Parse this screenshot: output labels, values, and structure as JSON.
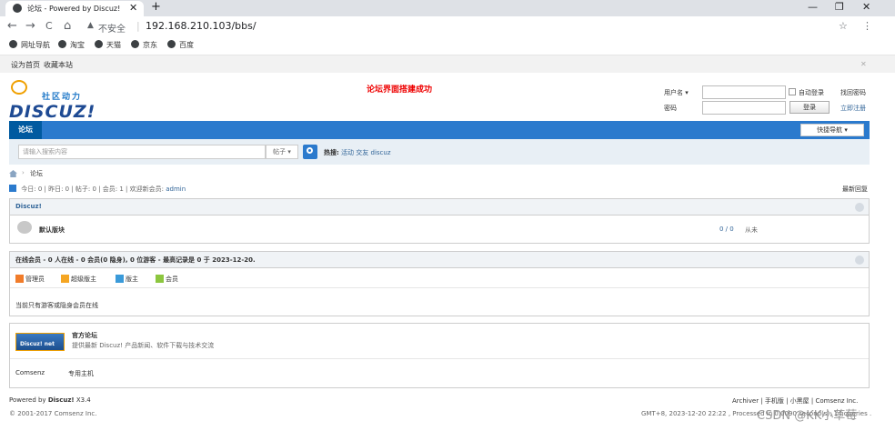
{
  "browser": {
    "tab_title": "论坛 - Powered by Discuz!",
    "tab_close": "✕",
    "new_tab": "+",
    "win_min": "—",
    "win_max": "❐",
    "win_close": "✕",
    "back": "←",
    "forward": "→",
    "reload": "C",
    "home": "⌂",
    "security": "不安全",
    "url": "192.168.210.103/bbs/",
    "star": "☆",
    "menu": "⋮",
    "bookmarks": [
      "网址导航",
      "淘宝",
      "天猫",
      "京东",
      "百度"
    ]
  },
  "toolbar": {
    "set_home": "设为首页",
    "bookmark_site": "收藏本站",
    "close": "✕"
  },
  "header": {
    "logo_sub": "社区动力",
    "logo_main": "DISCUZ!",
    "banner": "论坛界面搭建成功"
  },
  "login": {
    "username_label": "用户名 ▾",
    "password_label": "密码",
    "auto_login": "自动登录",
    "login_btn": "登录",
    "find_password": "找回密码",
    "register": "立即注册"
  },
  "nav": {
    "current": "论坛",
    "quick_nav": "快捷导航 ▾"
  },
  "search": {
    "placeholder": "请输入搜索内容",
    "type": "帖子 ▾",
    "hot_label": "热搜:",
    "hot_items": [
      "活动",
      "交友",
      "discuz"
    ]
  },
  "breadcrumb": {
    "sep": "›",
    "current": "论坛"
  },
  "stats": {
    "text": "今日: 0 | 昨日: 0 | 帖子: 0 | 会员: 1 | 欢迎新会员:",
    "newest_member": "admin",
    "new_posts": "最新回复"
  },
  "category": {
    "title": "Discuz!",
    "forum_name": "默认版块",
    "forum_counts": "0 / 0",
    "forum_last": "从未"
  },
  "online": {
    "title": "在线会员 - 0 人在线 - 0 会员(0 隐身), 0 位游客 - 最高记录是 0 于 2023-12-20.",
    "legend": [
      "管理员",
      "超级版主",
      "版主",
      "会员"
    ],
    "note": "当前只有游客或隐身会员在线"
  },
  "links": {
    "badge": "Discuz! net",
    "name": "官方论坛",
    "desc": "提供最新 Discuz! 产品新闻、软件下载与技术交流",
    "text_links": [
      "Comsenz",
      "专用主机"
    ]
  },
  "footer": {
    "powered_prefix": "Powered by",
    "powered_brand": "Discuz!",
    "version": "X3.4",
    "copyright": "© 2001-2017 Comsenz Inc.",
    "right_links": "Archiver | 手机版 | 小黑屋 | Comsenz Inc.",
    "gmt": "GMT+8, 2023-12-20 22:22 , Processed in 0.0090 second(s), 14 queries .",
    "watermark": "CSDN @KK小草莓"
  }
}
